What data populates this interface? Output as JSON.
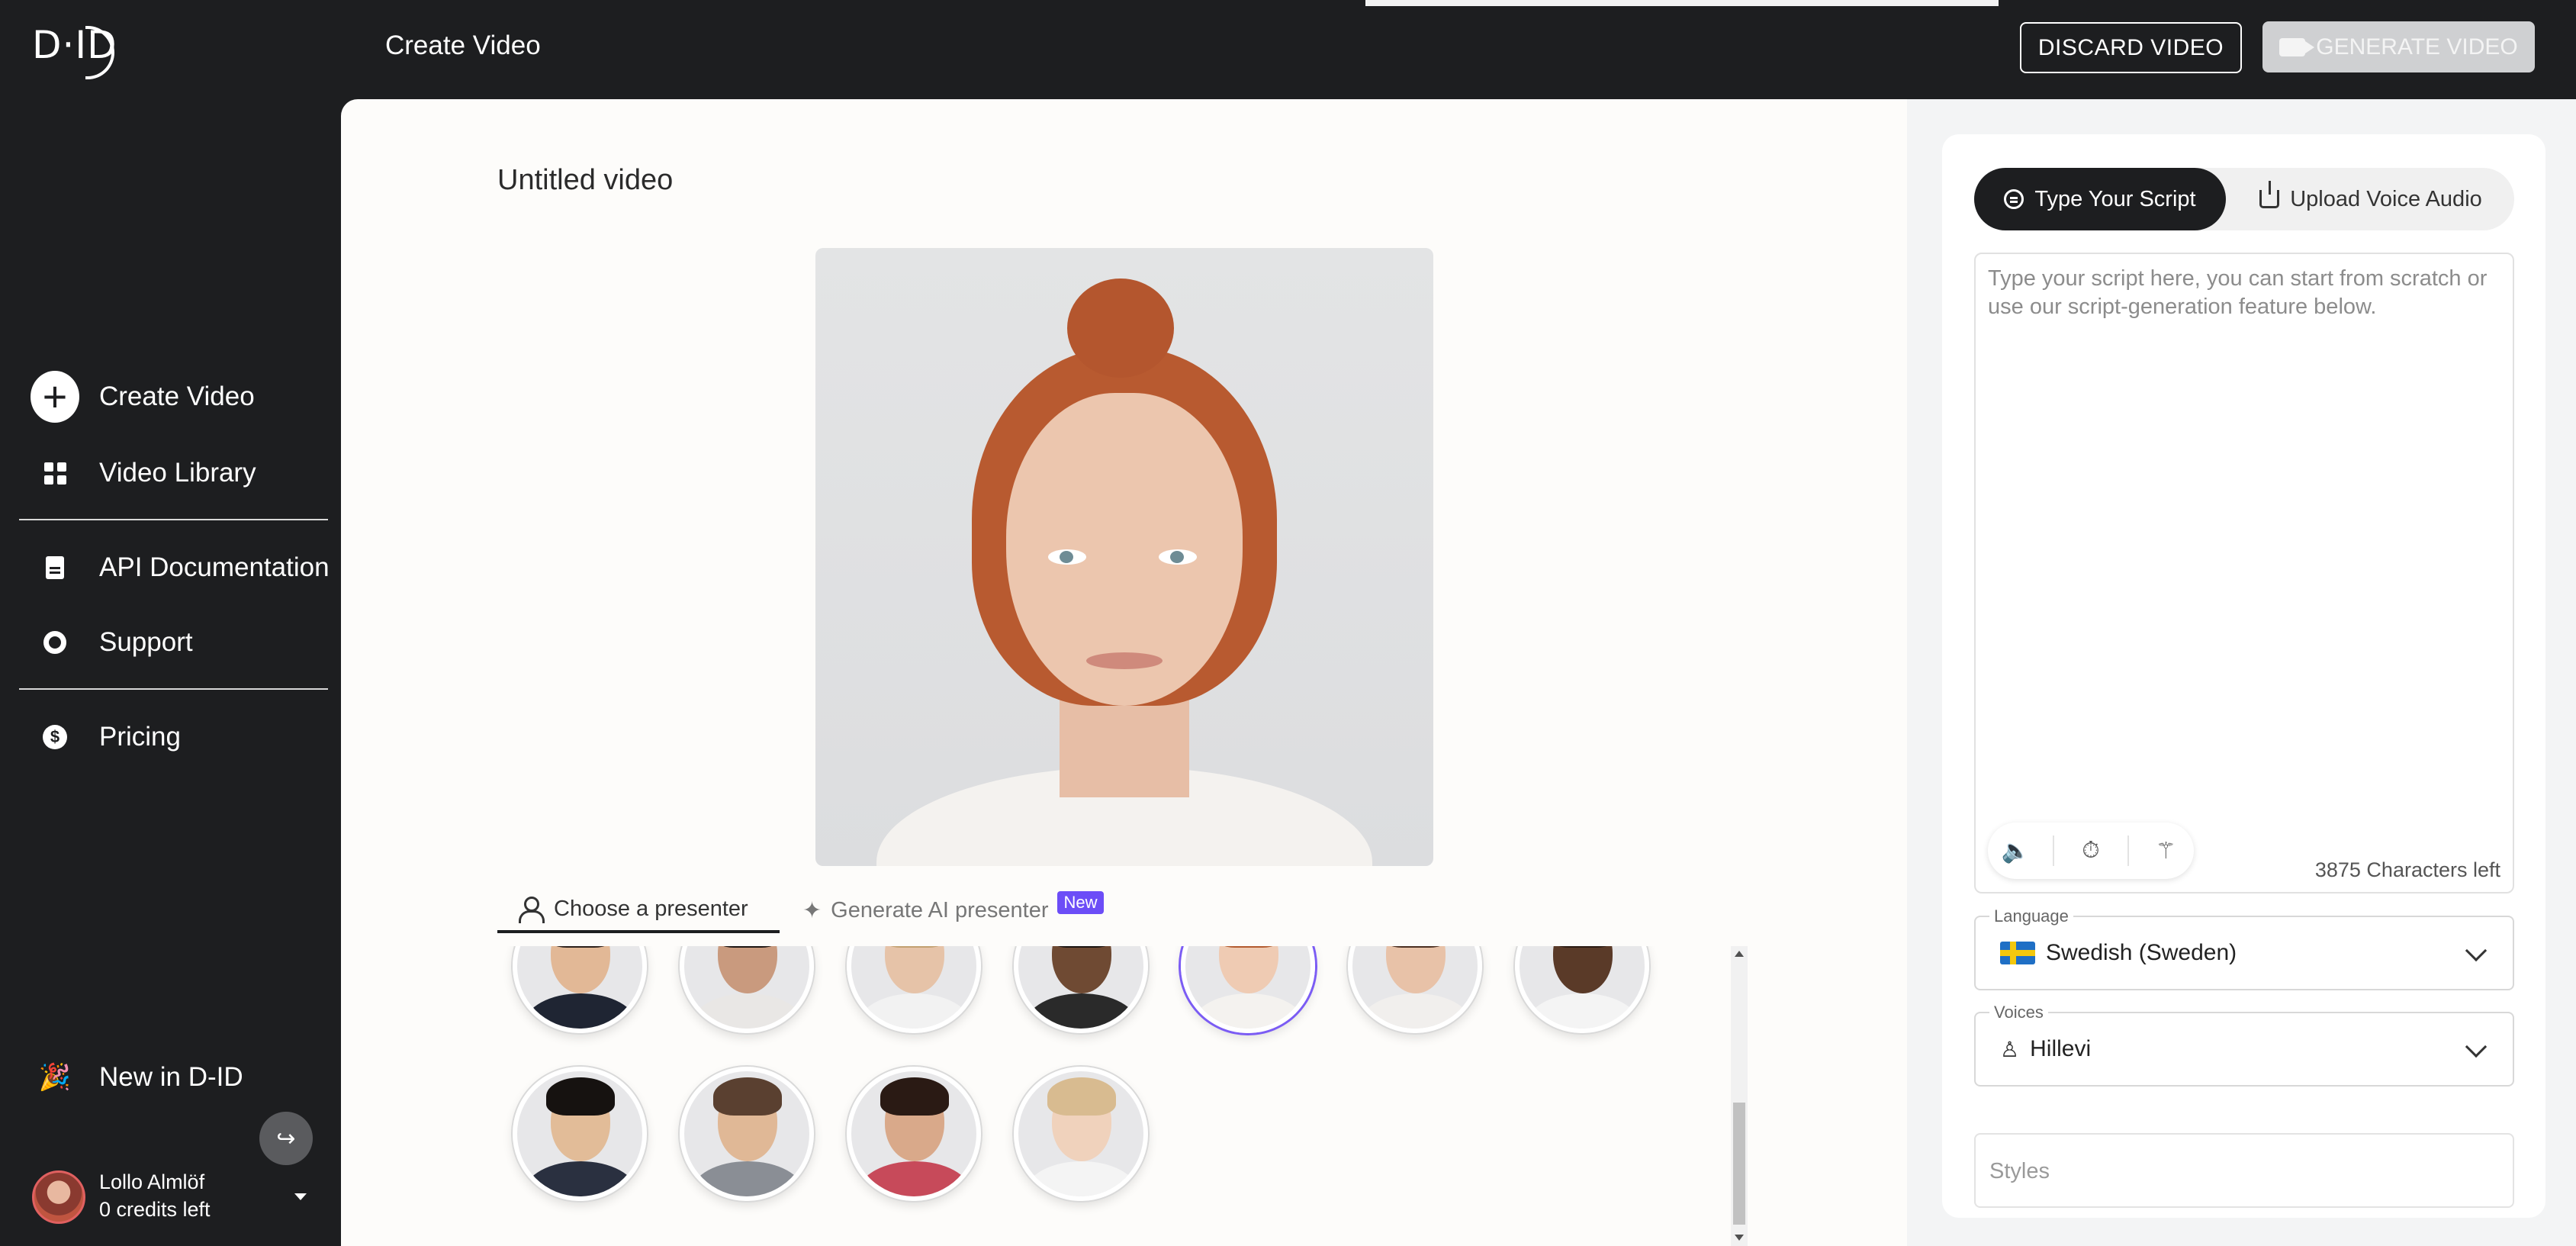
{
  "app": {
    "logo_text": "D·ID",
    "page_heading": "Create Video"
  },
  "header": {
    "discard_label": "DISCARD VIDEO",
    "generate_label": "GENERATE VIDEO"
  },
  "sidebar": {
    "items": [
      {
        "label": "Create Video",
        "icon": "plus-circle-icon"
      },
      {
        "label": "Video Library",
        "icon": "grid-icon"
      },
      {
        "label": "API Documentation",
        "icon": "document-icon"
      },
      {
        "label": "Support",
        "icon": "lifebuoy-icon"
      },
      {
        "label": "Pricing",
        "icon": "dollar-icon"
      },
      {
        "label": "New in D-ID",
        "icon": "party-popper-icon"
      }
    ],
    "user": {
      "name": "Lollo Almlöf",
      "credits": "0 credits left"
    }
  },
  "main": {
    "video_title": "Untitled video",
    "tabs": [
      {
        "label": "Choose a presenter",
        "active": true
      },
      {
        "label": "Generate AI presenter",
        "badge": "New",
        "active": false
      }
    ],
    "presenters": [
      {
        "name": "presenter-1",
        "selected": false,
        "skin": "#e2b896",
        "hair": "#2a1f1a",
        "shirt": "#1f2533"
      },
      {
        "name": "presenter-2",
        "selected": false,
        "skin": "#c99a7e",
        "hair": "#1c1412",
        "shirt": "#e9e7e5"
      },
      {
        "name": "presenter-3",
        "selected": false,
        "skin": "#e6c3a8",
        "hair": "#c2a070",
        "shirt": "#f2f2f2"
      },
      {
        "name": "presenter-4",
        "selected": false,
        "skin": "#6f4a33",
        "hair": "#1a1411",
        "shirt": "#2a2a2a"
      },
      {
        "name": "presenter-5",
        "selected": true,
        "skin": "#efcbb3",
        "hair": "#b25a2e",
        "shirt": "#f4f2ef"
      },
      {
        "name": "presenter-6",
        "selected": false,
        "skin": "#e8c2a8",
        "hair": "#4a2e20",
        "shirt": "#f1efed"
      },
      {
        "name": "presenter-7",
        "selected": false,
        "skin": "#5a3a28",
        "hair": "#2a1a12",
        "shirt": "#f4f4f4"
      },
      {
        "name": "presenter-8",
        "selected": false,
        "skin": "#e2bc98",
        "hair": "#161210",
        "shirt": "#2a3040"
      },
      {
        "name": "presenter-9",
        "selected": false,
        "skin": "#e0b896",
        "hair": "#5a4030",
        "shirt": "#8a8e95"
      },
      {
        "name": "presenter-10",
        "selected": false,
        "skin": "#d9a98a",
        "hair": "#2a1a14",
        "shirt": "#c74a5a"
      },
      {
        "name": "presenter-11",
        "selected": false,
        "skin": "#f0d2bc",
        "hair": "#d8bb90",
        "shirt": "#f4f4f4"
      }
    ]
  },
  "script": {
    "tabs": [
      {
        "label": "Type Your Script",
        "active": true,
        "icon": "chat-icon"
      },
      {
        "label": "Upload Voice Audio",
        "active": false,
        "icon": "upload-icon"
      }
    ],
    "value": "",
    "placeholder": "Type your script here, you can start from scratch or use our script-generation feature below.",
    "tools": [
      "speaker-icon",
      "timer-icon",
      "magic-wand-icon"
    ],
    "characters_left": "3875 Characters left"
  },
  "language": {
    "label": "Language",
    "value": "Swedish (Sweden)",
    "flag": "sweden-flag-icon"
  },
  "voices": {
    "label": "Voices",
    "value": "Hillevi"
  },
  "styles": {
    "placeholder": "Styles",
    "value": ""
  },
  "colors": {
    "dark": "#1d1e20",
    "accent": "#6c4df7",
    "selected_ring": "#7b5cf4",
    "disabled_button": "#cfd0d2"
  }
}
